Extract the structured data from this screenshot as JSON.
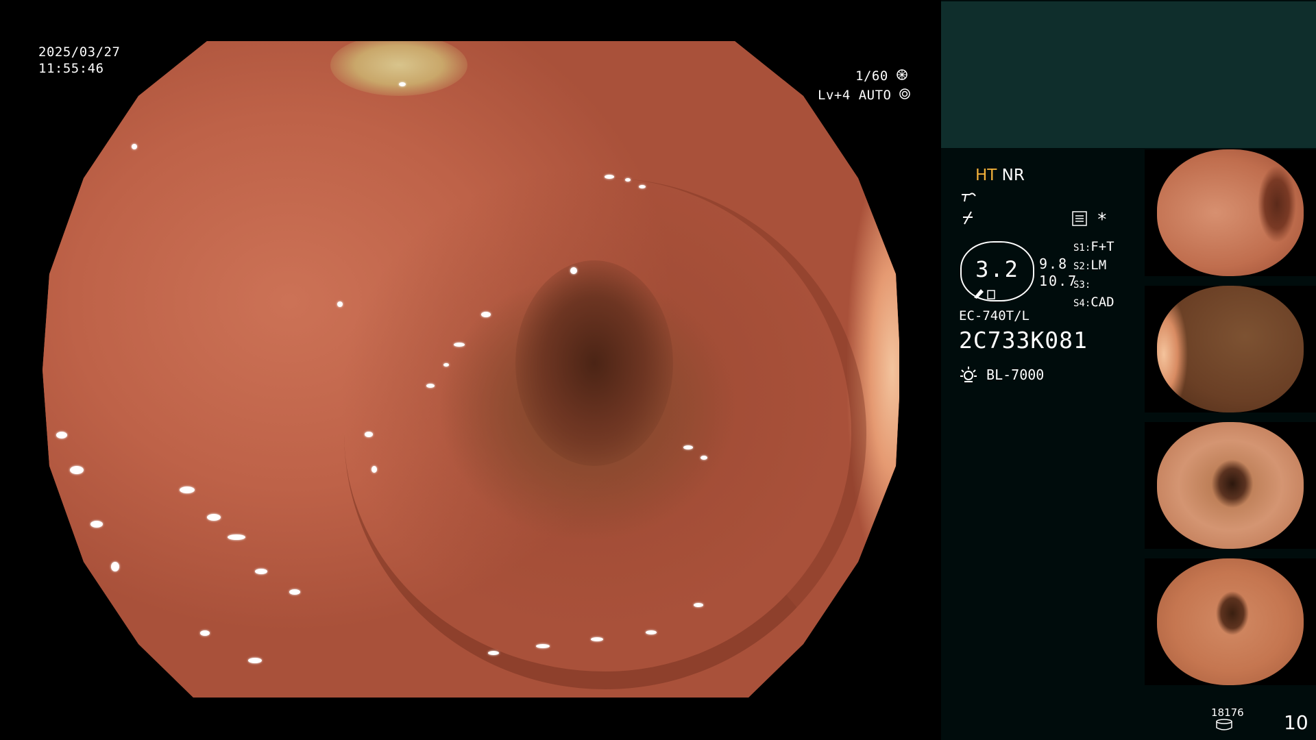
{
  "main_view": {
    "date": "2025/03/27",
    "time": "11:55:46",
    "shutter": "1/60",
    "level_mode": "Lv+4 AUTO"
  },
  "settings": {
    "ht_label": "HT",
    "nr_label": "NR",
    "magnification": "3.2",
    "value_top": "9.8",
    "value_bottom": "10.7",
    "scope_model": "EC-740T/L",
    "serial": "2C733K081",
    "light_source": "BL-7000",
    "switches": [
      {
        "key": "S1:",
        "value": "F+T"
      },
      {
        "key": "S2:",
        "value": "LM"
      },
      {
        "key": "S3:",
        "value": ""
      },
      {
        "key": "S4:",
        "value": "CAD"
      }
    ]
  },
  "footer": {
    "storage_count": "18176",
    "image_count": "10"
  },
  "thumbnails": [
    {
      "name": "thumb-1"
    },
    {
      "name": "thumb-2"
    },
    {
      "name": "thumb-3"
    },
    {
      "name": "thumb-4"
    }
  ],
  "icons": {
    "shutter": "aperture-icon",
    "auto": "auto-iris-icon",
    "enhance": "structure-enhance-icon",
    "color": "color-mode-icon",
    "menu": "menu-icon",
    "star": "asterisk-icon",
    "light": "light-source-icon",
    "storage": "storage-icon"
  }
}
